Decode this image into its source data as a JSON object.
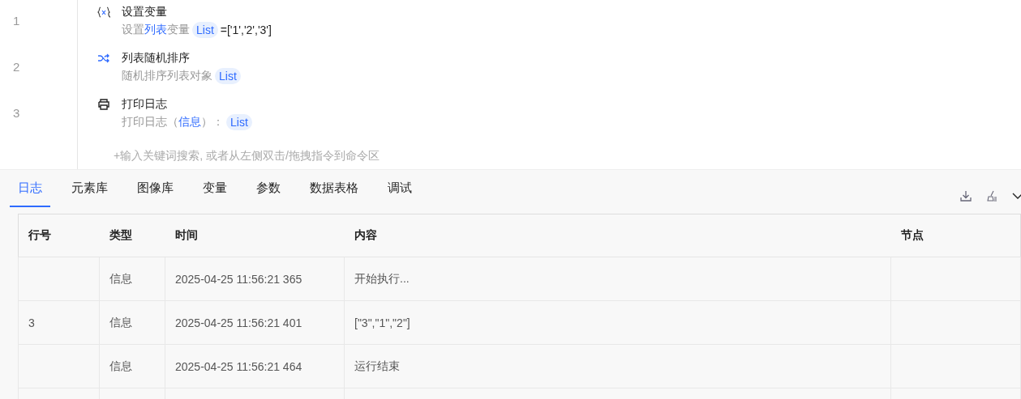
{
  "steps": [
    {
      "line": "1",
      "kind": "variable",
      "title": "设置变量",
      "description": [
        {
          "kind": "text",
          "text": "设置"
        },
        {
          "kind": "link",
          "text": "列表"
        },
        {
          "kind": "text",
          "text": "变量"
        },
        {
          "kind": "tag",
          "text": "List"
        },
        {
          "kind": "value",
          "text": "=['1','2','3']"
        }
      ]
    },
    {
      "line": "2",
      "kind": "shuffle",
      "title": "列表随机排序",
      "description": [
        {
          "kind": "text",
          "text": "随机排序列表对象"
        },
        {
          "kind": "tag",
          "text": "List"
        }
      ]
    },
    {
      "line": "3",
      "kind": "printer",
      "title": "打印日志",
      "description": [
        {
          "kind": "text",
          "text": "打印日志（"
        },
        {
          "kind": "link",
          "text": "信息"
        },
        {
          "kind": "text",
          "text": "）："
        },
        {
          "kind": "tag",
          "text": "List"
        }
      ]
    }
  ],
  "add_hint": "+输入关键词搜索, 或者从左侧双击/拖拽指令到命令区",
  "tabs": [
    {
      "label": "日志",
      "selected": true
    },
    {
      "label": "元素库",
      "selected": false
    },
    {
      "label": "图像库",
      "selected": false
    },
    {
      "label": "变量",
      "selected": false
    },
    {
      "label": "参数",
      "selected": false
    },
    {
      "label": "数据表格",
      "selected": false
    },
    {
      "label": "调试",
      "selected": false
    }
  ],
  "log_table": {
    "columns": [
      "行号",
      "类型",
      "时间",
      "内容",
      "节点"
    ],
    "rows": [
      [
        "",
        "信息",
        "2025-04-25 11:56:21 365",
        "开始执行...",
        ""
      ],
      [
        "3",
        "信息",
        "2025-04-25 11:56:21 401",
        "[\"3\",\"1\",\"2\"]",
        ""
      ],
      [
        "",
        "信息",
        "2025-04-25 11:56:21 464",
        "运行结束",
        ""
      ]
    ]
  }
}
